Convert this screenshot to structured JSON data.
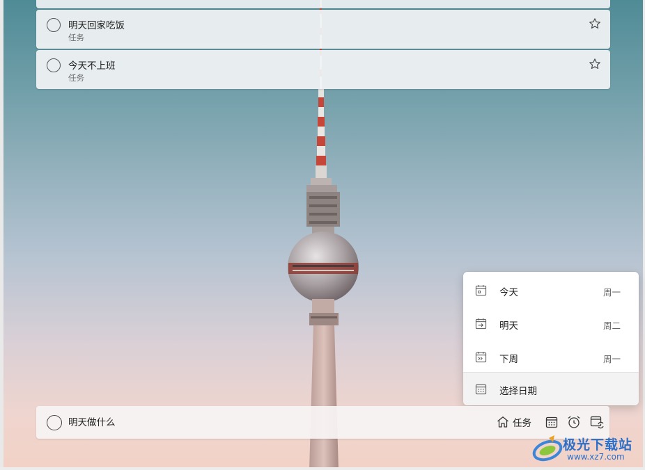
{
  "tasks": [
    {
      "title": "明天回家吃饭",
      "list": "任务"
    },
    {
      "title": "今天不上班",
      "list": "任务"
    }
  ],
  "add_task": {
    "value": "明天做什么",
    "list_label": "任务",
    "icons": [
      "house-icon",
      "calendar-icon",
      "alarm-clock-icon",
      "repeat-calendar-icon"
    ]
  },
  "due_menu": {
    "items": [
      {
        "label": "今天",
        "day": "周一",
        "icon": "calendar-today-icon"
      },
      {
        "label": "明天",
        "day": "周二",
        "icon": "calendar-tomorrow-icon"
      },
      {
        "label": "下周",
        "day": "周一",
        "icon": "calendar-next-week-icon"
      },
      {
        "label": "选择日期",
        "icon": "calendar-pick-date-icon"
      }
    ]
  },
  "watermark": {
    "name": "极光下载站",
    "url": "www.xz7.com"
  },
  "colors": {
    "sky_top": "#4f8b96",
    "sky_bottom": "#f2d2c6",
    "tower_red": "#c4473a"
  }
}
